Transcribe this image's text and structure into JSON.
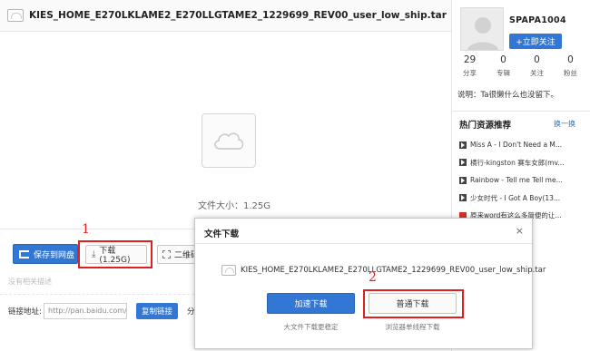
{
  "file": {
    "title": "KIES_HOME_E270LKLAME2_E270LLGTAME2_1229699_REV00_user_low_ship.tar",
    "size_text": "文件大小：1.25G"
  },
  "actions": {
    "save_label": "保存到网盘",
    "download_label": "下载(1.25G)",
    "qr_label": "二维码",
    "annotation_1": "1"
  },
  "related": {
    "label": "没有相关描述"
  },
  "share_link": {
    "label": "链接地址:",
    "value": "http://pan.baidu.com/sh",
    "copy_label": "复制链接",
    "extra": "分"
  },
  "user": {
    "name": "SPAPA1004",
    "follow_label": "+立即关注",
    "stats": [
      {
        "num": "29",
        "label": "分享"
      },
      {
        "num": "0",
        "label": "专辑"
      },
      {
        "num": "0",
        "label": "关注"
      },
      {
        "num": "0",
        "label": "粉丝"
      }
    ],
    "description": "说明：Ta很懒什么也没留下。"
  },
  "hot": {
    "title": "热门资源推荐",
    "more": "换一换",
    "items": [
      {
        "text": "Miss A - I Don't Need a M...",
        "icon": "video-icon"
      },
      {
        "text": "横行-kingston 赛车女郎(mv...",
        "icon": "video-icon"
      },
      {
        "text": "Rainbow - Tell me Tell me...",
        "icon": "video-icon"
      },
      {
        "text": "少女时代 - I Got A Boy(13...",
        "icon": "video-icon"
      },
      {
        "text": "原来word有这么多简便的让...",
        "icon": "pdf-icon"
      }
    ]
  },
  "dialog": {
    "title": "文件下载",
    "close": "×",
    "file_name": "KIES_HOME_E270LKLAME2_E270LLGTAME2_1229699_REV00_user_low_ship.tar",
    "fast_label": "加速下载",
    "fast_note": "大文件下载更稳定",
    "normal_label": "普通下载",
    "normal_note": "浏览器单线程下载",
    "annotation_2": "2"
  },
  "colors": {
    "accent": "#3277d3",
    "annotation": "#e02020"
  }
}
